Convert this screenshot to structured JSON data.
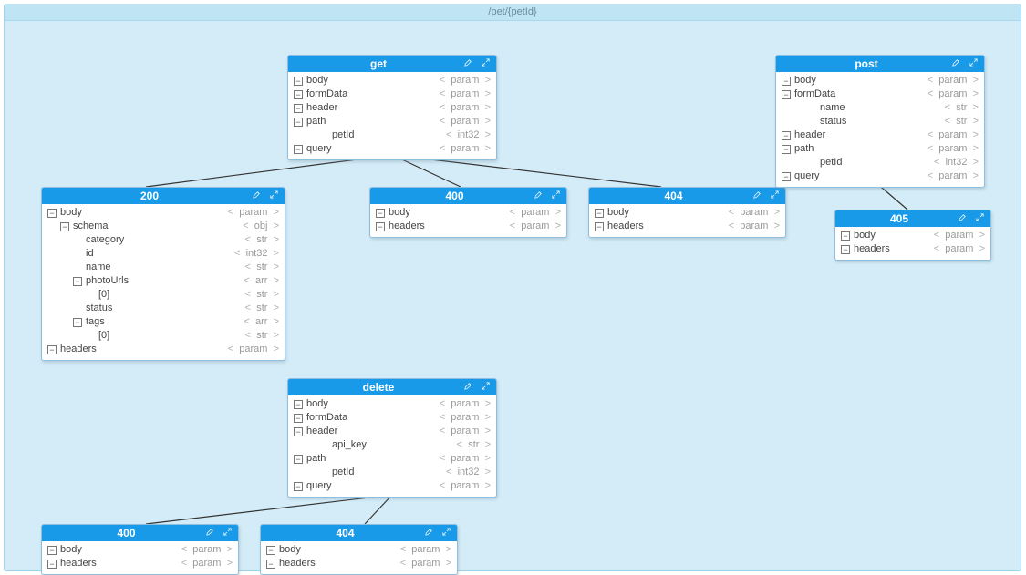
{
  "frame": {
    "title": "/pet/{petId}"
  },
  "types": {
    "param": "param",
    "int32": "int32",
    "str": "str",
    "obj": "obj",
    "arr": "arr"
  },
  "toggles": {
    "minus": "−",
    "plus": "+"
  },
  "nodes": {
    "get": {
      "title": "get",
      "rows": [
        {
          "indent": 0,
          "toggle": "minus",
          "label": "body",
          "type": "param"
        },
        {
          "indent": 0,
          "toggle": "minus",
          "label": "formData",
          "type": "param"
        },
        {
          "indent": 0,
          "toggle": "minus",
          "label": "header",
          "type": "param"
        },
        {
          "indent": 0,
          "toggle": "minus",
          "label": "path",
          "type": "param"
        },
        {
          "indent": 2,
          "toggle": "none",
          "label": "petId",
          "type": "int32"
        },
        {
          "indent": 0,
          "toggle": "minus",
          "label": "query",
          "type": "param"
        }
      ]
    },
    "r200": {
      "title": "200",
      "rows": [
        {
          "indent": 0,
          "toggle": "minus",
          "label": "body",
          "type": "param"
        },
        {
          "indent": 1,
          "toggle": "minus",
          "label": "schema",
          "type": "obj"
        },
        {
          "indent": 2,
          "toggle": "none",
          "label": "category",
          "type": "str"
        },
        {
          "indent": 2,
          "toggle": "none",
          "label": "id",
          "type": "int32"
        },
        {
          "indent": 2,
          "toggle": "none",
          "label": "name",
          "type": "str"
        },
        {
          "indent": 2,
          "toggle": "minus",
          "label": "photoUrls",
          "type": "arr"
        },
        {
          "indent": 3,
          "toggle": "none",
          "label": "[0]",
          "type": "str"
        },
        {
          "indent": 2,
          "toggle": "none",
          "label": "status",
          "type": "str"
        },
        {
          "indent": 2,
          "toggle": "minus",
          "label": "tags",
          "type": "arr"
        },
        {
          "indent": 3,
          "toggle": "none",
          "label": "[0]",
          "type": "str"
        },
        {
          "indent": 0,
          "toggle": "minus",
          "label": "headers",
          "type": "param"
        }
      ]
    },
    "r400": {
      "title": "400",
      "rows": [
        {
          "indent": 0,
          "toggle": "minus",
          "label": "body",
          "type": "param"
        },
        {
          "indent": 0,
          "toggle": "minus",
          "label": "headers",
          "type": "param"
        }
      ]
    },
    "r404": {
      "title": "404",
      "rows": [
        {
          "indent": 0,
          "toggle": "minus",
          "label": "body",
          "type": "param"
        },
        {
          "indent": 0,
          "toggle": "minus",
          "label": "headers",
          "type": "param"
        }
      ]
    },
    "post": {
      "title": "post",
      "rows": [
        {
          "indent": 0,
          "toggle": "minus",
          "label": "body",
          "type": "param"
        },
        {
          "indent": 0,
          "toggle": "minus",
          "label": "formData",
          "type": "param"
        },
        {
          "indent": 2,
          "toggle": "none",
          "label": "name",
          "type": "str"
        },
        {
          "indent": 2,
          "toggle": "none",
          "label": "status",
          "type": "str"
        },
        {
          "indent": 0,
          "toggle": "minus",
          "label": "header",
          "type": "param"
        },
        {
          "indent": 0,
          "toggle": "minus",
          "label": "path",
          "type": "param"
        },
        {
          "indent": 2,
          "toggle": "none",
          "label": "petId",
          "type": "int32"
        },
        {
          "indent": 0,
          "toggle": "minus",
          "label": "query",
          "type": "param"
        }
      ]
    },
    "r405": {
      "title": "405",
      "rows": [
        {
          "indent": 0,
          "toggle": "minus",
          "label": "body",
          "type": "param"
        },
        {
          "indent": 0,
          "toggle": "minus",
          "label": "headers",
          "type": "param"
        }
      ]
    },
    "delete": {
      "title": "delete",
      "rows": [
        {
          "indent": 0,
          "toggle": "minus",
          "label": "body",
          "type": "param"
        },
        {
          "indent": 0,
          "toggle": "minus",
          "label": "formData",
          "type": "param"
        },
        {
          "indent": 0,
          "toggle": "minus",
          "label": "header",
          "type": "param"
        },
        {
          "indent": 2,
          "toggle": "none",
          "label": "api_key",
          "type": "str"
        },
        {
          "indent": 0,
          "toggle": "minus",
          "label": "path",
          "type": "param"
        },
        {
          "indent": 2,
          "toggle": "none",
          "label": "petId",
          "type": "int32"
        },
        {
          "indent": 0,
          "toggle": "minus",
          "label": "query",
          "type": "param"
        }
      ]
    },
    "d400": {
      "title": "400",
      "rows": [
        {
          "indent": 0,
          "toggle": "minus",
          "label": "body",
          "type": "param"
        },
        {
          "indent": 0,
          "toggle": "minus",
          "label": "headers",
          "type": "param"
        }
      ]
    },
    "d404": {
      "title": "404",
      "rows": [
        {
          "indent": 0,
          "toggle": "minus",
          "label": "body",
          "type": "param"
        },
        {
          "indent": 0,
          "toggle": "minus",
          "label": "headers",
          "type": "param"
        }
      ]
    }
  }
}
